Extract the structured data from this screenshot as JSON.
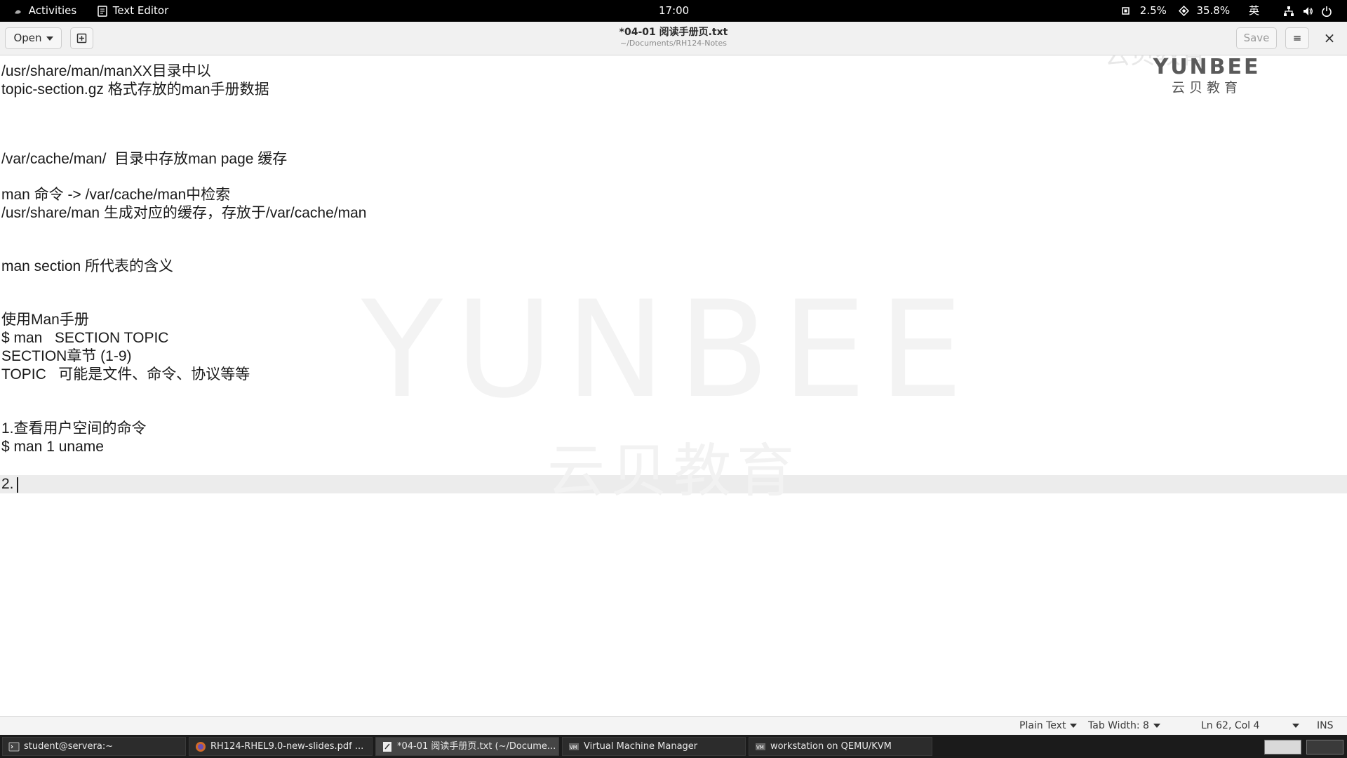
{
  "topbar": {
    "activities": "Activities",
    "app_name": "Text Editor",
    "clock": "17:00",
    "cpu": "2.5%",
    "mem": "35.8%",
    "input_method": "英"
  },
  "headerbar": {
    "open_label": "Open",
    "title": "*04-01 阅读手册页.txt",
    "subtitle": "~/Documents/RH124-Notes",
    "save_label": "Save",
    "menu_glyph": "≡",
    "close_glyph": "×"
  },
  "watermark": {
    "big_text": "YUNBEE",
    "small_text": "云贝教育",
    "logo_en": "YUNBEE",
    "logo_cn": "云贝教育",
    "logo_ghost": "云贝教育"
  },
  "editor": {
    "lines": [
      "/usr/share/man/manXX目录中以",
      "topic-section.gz 格式存放的man手册数据",
      "/var/cache/man/  目录中存放man page 缓存",
      "man 命令 -> /var/cache/man中检索",
      "/usr/share/man 生成对应的缓存，存放于/var/cache/man",
      "man section 所代表的含义",
      "使用Man手册",
      "$ man   SECTION TOPIC",
      "SECTION章节 (1-9)",
      "TOPIC   可能是文件、命令、协议等等",
      "1.查看用户空间的命令",
      "$ man 1 uname",
      "2."
    ]
  },
  "statusbar": {
    "language": "Plain Text",
    "tab_width": "Tab Width: 8",
    "position": "Ln 62, Col 4",
    "mode": "INS"
  },
  "taskbar": {
    "tasks": [
      "student@servera:~",
      "RH124-RHEL9.0-new-slides.pdf ...",
      "*04-01 阅读手册页.txt (~/Docume...",
      "Virtual Machine Manager",
      "workstation on QEMU/KVM"
    ]
  }
}
